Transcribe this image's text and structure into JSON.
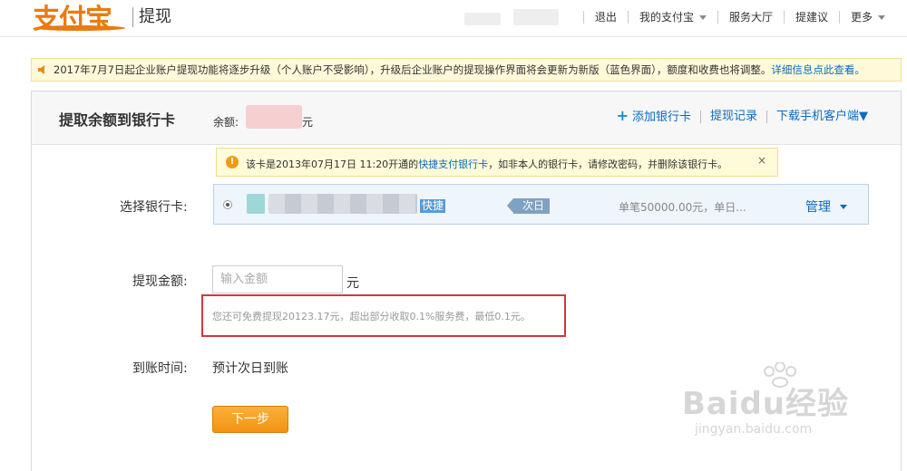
{
  "header": {
    "logo_text": "支付宝",
    "page_name": "提现",
    "nav": [
      {
        "label": "退出",
        "caret": false
      },
      {
        "label": "我的支付宝",
        "caret": true
      },
      {
        "label": "服务大厅",
        "caret": false
      },
      {
        "label": "提建议",
        "caret": false
      },
      {
        "label": "更多",
        "caret": true
      }
    ]
  },
  "notice": {
    "text": "2017年7月7日起企业账户提现功能将逐步升级（个人账户不受影响），升级后企业账户的提现操作界面将会更新为新版（蓝色界面），额度和收费也将调整。",
    "link": "详细信息点此查看。"
  },
  "card": {
    "title": "提取余额到银行卡",
    "balance_label": "余额:",
    "balance_unit": "元",
    "links": {
      "add_card": "添加银行卡",
      "records": "提现记录",
      "download": "下载手机客户端▼"
    }
  },
  "tip": {
    "prefix": "该卡是2013年07月17日 11:20开通的",
    "link": "快捷支付银行卡",
    "suffix": "，如非本人的银行卡，请修改密码，并删除该银行卡。",
    "close": "×"
  },
  "form": {
    "select_card_label": "选择银行卡:",
    "bank_card": {
      "quick_tag": "快捷",
      "arrival_tag": "次日",
      "limit_text": "单笔50000.00元，单日...",
      "manage_label": "管理"
    },
    "amount_label": "提现金额:",
    "amount_placeholder": "输入金额",
    "amount_unit": "元",
    "free_hint": "您还可免费提现20123.17元，超出部分收取0.1%服务费，最低0.1元。",
    "eta_label": "到账时间:",
    "eta_value": "预计次日到账",
    "next_button": "下一步"
  },
  "watermark": {
    "brand": "Baidu经验",
    "url": "jingyan.baidu.com"
  },
  "colors": {
    "brand_orange": "#e87b11",
    "link_blue": "#0a6bc2",
    "highlight_red": "#d0383c",
    "button_orange": "#f29312"
  }
}
